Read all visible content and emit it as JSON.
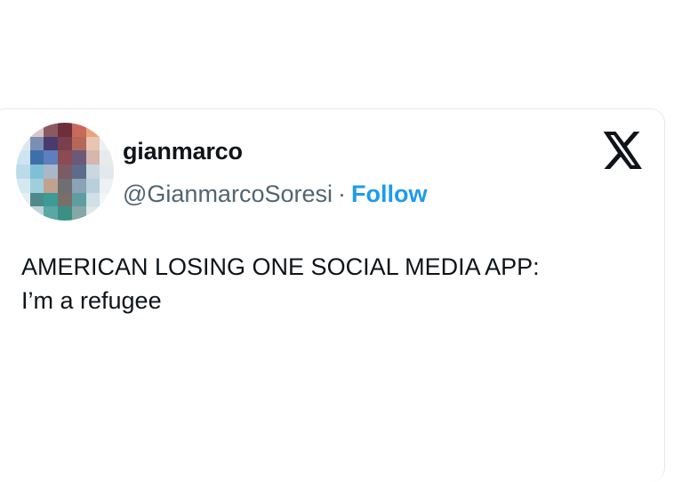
{
  "user": {
    "display_name": "gianmarco",
    "handle": "@GianmarcoSoresi",
    "separator": "·",
    "follow_label": "Follow",
    "avatar_icon": "pixelated-avatar-icon"
  },
  "brand": {
    "logo_icon": "x-logo-icon"
  },
  "tweet": {
    "lines": [
      "AMERICAN LOSING ONE SOCIAL MEDIA APP:",
      "I’m a refugee"
    ]
  },
  "colors": {
    "link": "#1d9bf0",
    "text": "#0f1419",
    "secondary": "#536471"
  }
}
